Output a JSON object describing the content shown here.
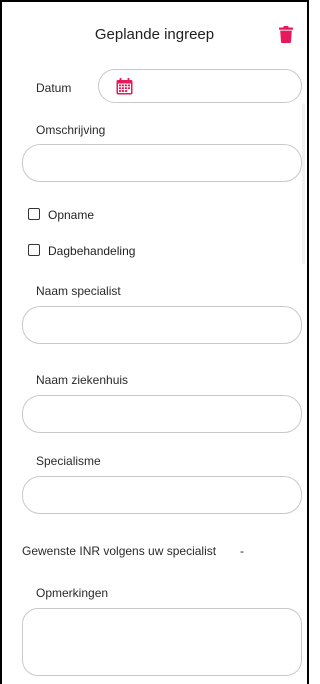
{
  "header": {
    "title": "Geplande ingreep",
    "delete_icon": "trash-icon",
    "accent_color": "#e8195a"
  },
  "form": {
    "date_label": "Datum",
    "date_icon": "calendar-icon",
    "description_label": "Omschrijving",
    "description_value": "",
    "admission_label": "Opname",
    "admission_checked": false,
    "daycare_label": "Dagbehandeling",
    "daycare_checked": false,
    "specialist_name_label": "Naam specialist",
    "specialist_name_value": "",
    "hospital_name_label": "Naam ziekenhuis",
    "hospital_name_value": "",
    "specialism_label": "Specialisme",
    "specialism_value": "",
    "inr_label": "Gewenste INR volgens uw specialist",
    "inr_value": "-",
    "remarks_label": "Opmerkingen",
    "remarks_value": ""
  }
}
